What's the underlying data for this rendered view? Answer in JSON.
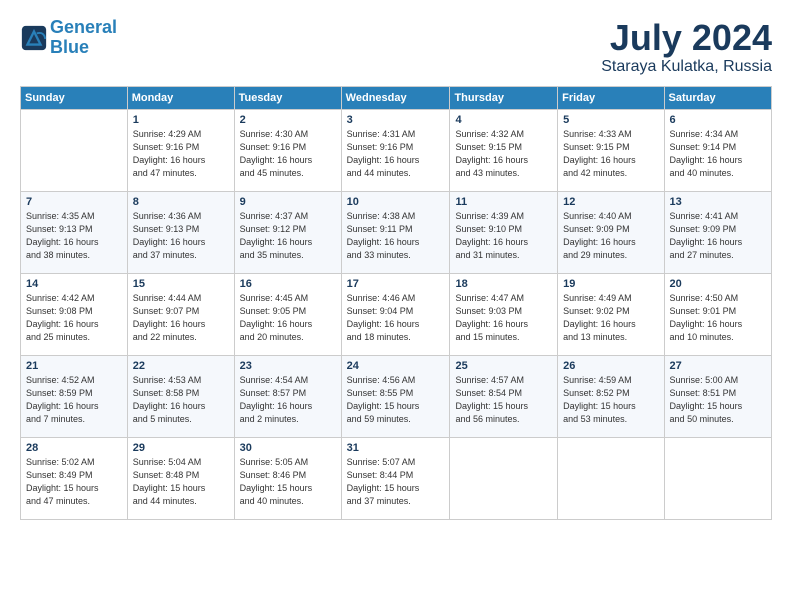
{
  "header": {
    "logo_line1": "General",
    "logo_line2": "Blue",
    "month_year": "July 2024",
    "location": "Staraya Kulatka, Russia"
  },
  "weekdays": [
    "Sunday",
    "Monday",
    "Tuesday",
    "Wednesday",
    "Thursday",
    "Friday",
    "Saturday"
  ],
  "weeks": [
    [
      {
        "day": "",
        "info": ""
      },
      {
        "day": "1",
        "info": "Sunrise: 4:29 AM\nSunset: 9:16 PM\nDaylight: 16 hours\nand 47 minutes."
      },
      {
        "day": "2",
        "info": "Sunrise: 4:30 AM\nSunset: 9:16 PM\nDaylight: 16 hours\nand 45 minutes."
      },
      {
        "day": "3",
        "info": "Sunrise: 4:31 AM\nSunset: 9:16 PM\nDaylight: 16 hours\nand 44 minutes."
      },
      {
        "day": "4",
        "info": "Sunrise: 4:32 AM\nSunset: 9:15 PM\nDaylight: 16 hours\nand 43 minutes."
      },
      {
        "day": "5",
        "info": "Sunrise: 4:33 AM\nSunset: 9:15 PM\nDaylight: 16 hours\nand 42 minutes."
      },
      {
        "day": "6",
        "info": "Sunrise: 4:34 AM\nSunset: 9:14 PM\nDaylight: 16 hours\nand 40 minutes."
      }
    ],
    [
      {
        "day": "7",
        "info": "Sunrise: 4:35 AM\nSunset: 9:13 PM\nDaylight: 16 hours\nand 38 minutes."
      },
      {
        "day": "8",
        "info": "Sunrise: 4:36 AM\nSunset: 9:13 PM\nDaylight: 16 hours\nand 37 minutes."
      },
      {
        "day": "9",
        "info": "Sunrise: 4:37 AM\nSunset: 9:12 PM\nDaylight: 16 hours\nand 35 minutes."
      },
      {
        "day": "10",
        "info": "Sunrise: 4:38 AM\nSunset: 9:11 PM\nDaylight: 16 hours\nand 33 minutes."
      },
      {
        "day": "11",
        "info": "Sunrise: 4:39 AM\nSunset: 9:10 PM\nDaylight: 16 hours\nand 31 minutes."
      },
      {
        "day": "12",
        "info": "Sunrise: 4:40 AM\nSunset: 9:09 PM\nDaylight: 16 hours\nand 29 minutes."
      },
      {
        "day": "13",
        "info": "Sunrise: 4:41 AM\nSunset: 9:09 PM\nDaylight: 16 hours\nand 27 minutes."
      }
    ],
    [
      {
        "day": "14",
        "info": "Sunrise: 4:42 AM\nSunset: 9:08 PM\nDaylight: 16 hours\nand 25 minutes."
      },
      {
        "day": "15",
        "info": "Sunrise: 4:44 AM\nSunset: 9:07 PM\nDaylight: 16 hours\nand 22 minutes."
      },
      {
        "day": "16",
        "info": "Sunrise: 4:45 AM\nSunset: 9:05 PM\nDaylight: 16 hours\nand 20 minutes."
      },
      {
        "day": "17",
        "info": "Sunrise: 4:46 AM\nSunset: 9:04 PM\nDaylight: 16 hours\nand 18 minutes."
      },
      {
        "day": "18",
        "info": "Sunrise: 4:47 AM\nSunset: 9:03 PM\nDaylight: 16 hours\nand 15 minutes."
      },
      {
        "day": "19",
        "info": "Sunrise: 4:49 AM\nSunset: 9:02 PM\nDaylight: 16 hours\nand 13 minutes."
      },
      {
        "day": "20",
        "info": "Sunrise: 4:50 AM\nSunset: 9:01 PM\nDaylight: 16 hours\nand 10 minutes."
      }
    ],
    [
      {
        "day": "21",
        "info": "Sunrise: 4:52 AM\nSunset: 8:59 PM\nDaylight: 16 hours\nand 7 minutes."
      },
      {
        "day": "22",
        "info": "Sunrise: 4:53 AM\nSunset: 8:58 PM\nDaylight: 16 hours\nand 5 minutes."
      },
      {
        "day": "23",
        "info": "Sunrise: 4:54 AM\nSunset: 8:57 PM\nDaylight: 16 hours\nand 2 minutes."
      },
      {
        "day": "24",
        "info": "Sunrise: 4:56 AM\nSunset: 8:55 PM\nDaylight: 15 hours\nand 59 minutes."
      },
      {
        "day": "25",
        "info": "Sunrise: 4:57 AM\nSunset: 8:54 PM\nDaylight: 15 hours\nand 56 minutes."
      },
      {
        "day": "26",
        "info": "Sunrise: 4:59 AM\nSunset: 8:52 PM\nDaylight: 15 hours\nand 53 minutes."
      },
      {
        "day": "27",
        "info": "Sunrise: 5:00 AM\nSunset: 8:51 PM\nDaylight: 15 hours\nand 50 minutes."
      }
    ],
    [
      {
        "day": "28",
        "info": "Sunrise: 5:02 AM\nSunset: 8:49 PM\nDaylight: 15 hours\nand 47 minutes."
      },
      {
        "day": "29",
        "info": "Sunrise: 5:04 AM\nSunset: 8:48 PM\nDaylight: 15 hours\nand 44 minutes."
      },
      {
        "day": "30",
        "info": "Sunrise: 5:05 AM\nSunset: 8:46 PM\nDaylight: 15 hours\nand 40 minutes."
      },
      {
        "day": "31",
        "info": "Sunrise: 5:07 AM\nSunset: 8:44 PM\nDaylight: 15 hours\nand 37 minutes."
      },
      {
        "day": "",
        "info": ""
      },
      {
        "day": "",
        "info": ""
      },
      {
        "day": "",
        "info": ""
      }
    ]
  ]
}
